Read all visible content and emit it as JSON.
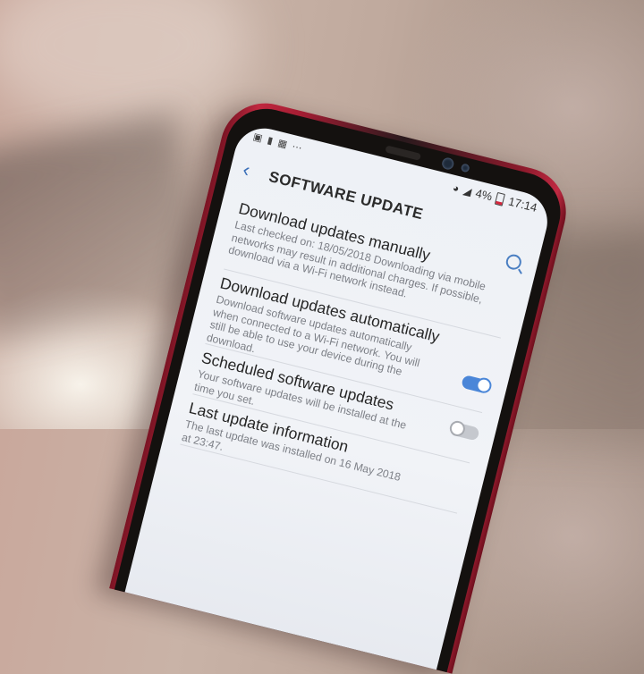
{
  "status_bar": {
    "notification_icons": [
      "facebook-icon",
      "clipboard-icon",
      "gallery-icon",
      "more-icon"
    ],
    "battery": "4%",
    "time": "17:14"
  },
  "header": {
    "title": "SOFTWARE UPDATE"
  },
  "items": [
    {
      "title": "Download updates manually",
      "desc": "Last checked on: 18/05/2018 Downloading via mobile networks may result in additional charges. If possible, download via a Wi-Fi network instead."
    },
    {
      "title": "Download updates automatically",
      "desc": "Download software updates automatically when connected to a Wi-Fi network. You will still be able to use your device during the download.",
      "toggle": true
    },
    {
      "title": "Scheduled software updates",
      "desc": "Your software updates will be installed at the time you set.",
      "toggle": false
    },
    {
      "title": "Last update information",
      "desc": "The last update was installed on 16 May 2018 at 23:47."
    }
  ],
  "colors": {
    "accent": "#4a86d8",
    "phone_body": "#b3233a"
  }
}
